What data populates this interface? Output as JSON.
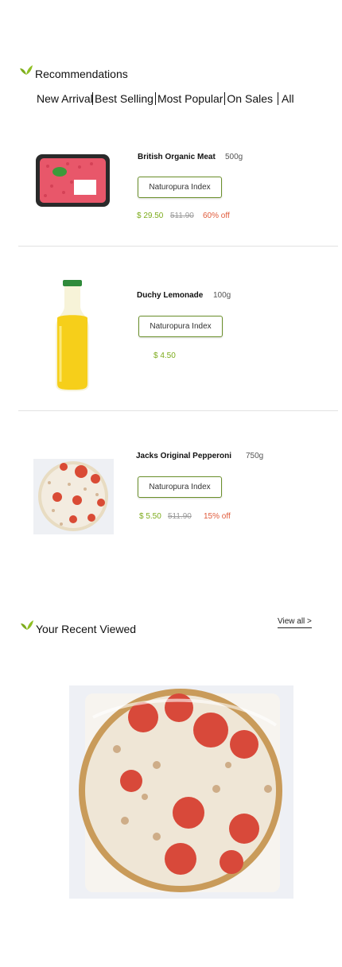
{
  "recommendations": {
    "title": "Recommendations",
    "tabs": [
      "New Arrivals",
      "Best Selling",
      "Most Popular",
      "On Sales",
      "All"
    ]
  },
  "products": [
    {
      "name": "British Organic Meat",
      "weight": "500g",
      "index_label": "Naturopura Index",
      "price": "$ 29.50",
      "old_price": "511.90",
      "discount": "60% off"
    },
    {
      "name": "Duchy Lemonade",
      "weight": "100g",
      "index_label": "Naturopura Index",
      "price": "$ 4.50"
    },
    {
      "name": "Jacks Original Pepperoni",
      "weight": "750g",
      "index_label": "Naturopura Index",
      "price": "$ 5.50",
      "old_price": "511.90",
      "discount": "15% off"
    }
  ],
  "recent": {
    "title": "Your Recent Viewed",
    "view_all": "View all >"
  },
  "colors": {
    "accent_green": "#7cab1b",
    "discount_red": "#e05a3a",
    "button_border": "#6a8f2a"
  }
}
